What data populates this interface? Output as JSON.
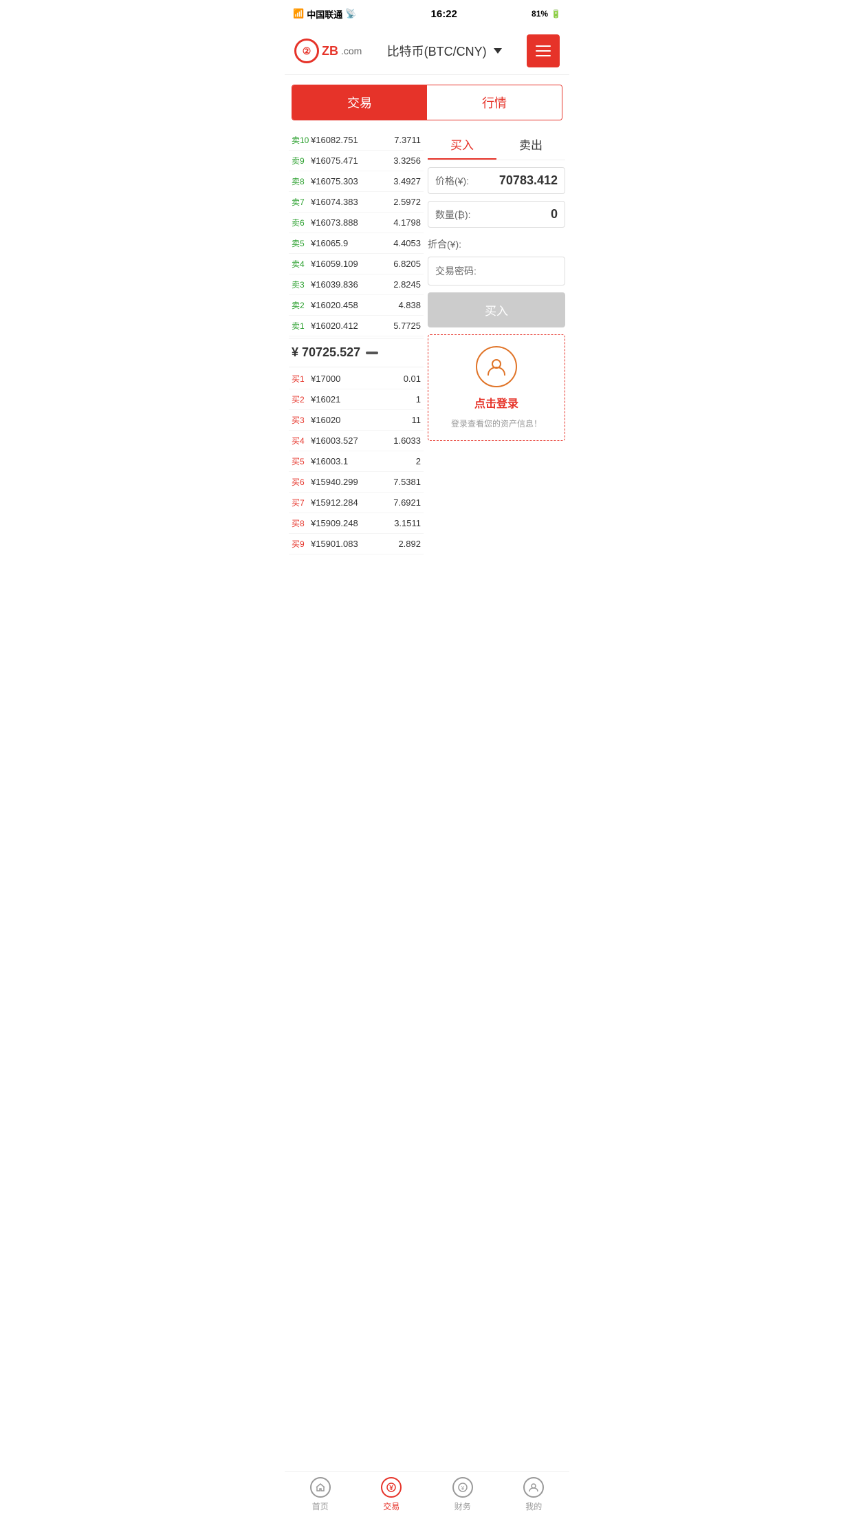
{
  "statusBar": {
    "carrier": "中国联通",
    "time": "16:22",
    "battery": "81%"
  },
  "header": {
    "logoText": "ZB",
    "logoDomain": ".com",
    "title": "比特币(BTC/CNY)",
    "menuAriaLabel": "菜单"
  },
  "mainTabs": {
    "tab1": {
      "label": "交易",
      "active": true
    },
    "tab2": {
      "label": "行情",
      "active": false
    }
  },
  "buySellTabs": {
    "buy": "买入",
    "sell": "卖出",
    "activeTab": "buy"
  },
  "sellOrders": [
    {
      "label": "卖10",
      "price": "¥16082.751",
      "amount": "7.3711"
    },
    {
      "label": "卖9",
      "price": "¥16075.471",
      "amount": "3.3256"
    },
    {
      "label": "卖8",
      "price": "¥16075.303",
      "amount": "3.4927"
    },
    {
      "label": "卖7",
      "price": "¥16074.383",
      "amount": "2.5972"
    },
    {
      "label": "卖6",
      "price": "¥16073.888",
      "amount": "4.1798"
    },
    {
      "label": "卖5",
      "price": "¥16065.9",
      "amount": "4.4053"
    },
    {
      "label": "卖4",
      "price": "¥16059.109",
      "amount": "6.8205"
    },
    {
      "label": "卖3",
      "price": "¥16039.836",
      "amount": "2.8245"
    },
    {
      "label": "卖2",
      "price": "¥16020.458",
      "amount": "4.838"
    },
    {
      "label": "卖1",
      "price": "¥16020.412",
      "amount": "5.7725"
    }
  ],
  "currentPrice": {
    "price": "¥ 70725.527",
    "indicator": "—"
  },
  "buyOrders": [
    {
      "label": "买1",
      "price": "¥17000",
      "amount": "0.01"
    },
    {
      "label": "买2",
      "price": "¥16021",
      "amount": "1"
    },
    {
      "label": "买3",
      "price": "¥16020",
      "amount": "11"
    },
    {
      "label": "买4",
      "price": "¥16003.527",
      "amount": "1.6033"
    },
    {
      "label": "买5",
      "price": "¥16003.1",
      "amount": "2"
    },
    {
      "label": "买6",
      "price": "¥15940.299",
      "amount": "7.5381"
    },
    {
      "label": "买7",
      "price": "¥15912.284",
      "amount": "7.6921"
    },
    {
      "label": "买8",
      "price": "¥15909.248",
      "amount": "3.1511"
    },
    {
      "label": "买9",
      "price": "¥15901.083",
      "amount": "2.892"
    }
  ],
  "orderForm": {
    "priceLabel": "价格(¥):",
    "priceValue": "70783.412",
    "quantityLabel": "数量(₿):",
    "quantityValue": "0",
    "zheheLabel": "折合(¥):",
    "passwordLabel": "交易密码:",
    "buyButtonLabel": "买入"
  },
  "loginSection": {
    "clickToLoginText": "点击登录",
    "descText": "登录查看您的资产信息！"
  },
  "bottomNav": [
    {
      "label": "首页",
      "icon": "star",
      "active": false
    },
    {
      "label": "交易",
      "icon": "yen",
      "active": true
    },
    {
      "label": "财务",
      "icon": "bag",
      "active": false
    },
    {
      "label": "我的",
      "icon": "person",
      "active": false
    }
  ]
}
